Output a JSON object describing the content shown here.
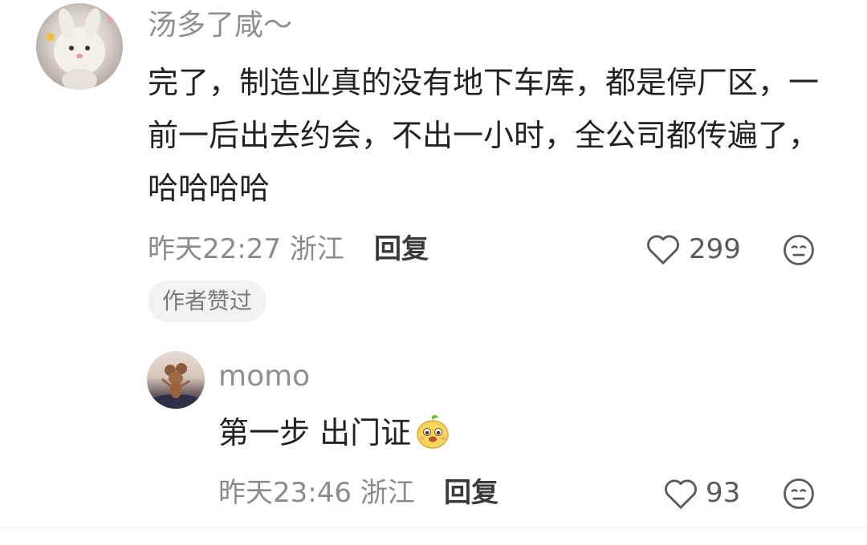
{
  "comment": {
    "username": "汤多了咸～",
    "text": "完了，制造业真的没有地下车库，都是停厂区，一前一后出去约会，不出一小时，全公司都传遍了，哈哈哈哈",
    "meta": "昨天22:27 浙江",
    "reply_label": "回复",
    "likes": "299",
    "badge": "作者赞过"
  },
  "reply": {
    "username": "momo",
    "text": "第一步 出门证",
    "emoji": "mango-face-emoji",
    "meta": "昨天23:46 浙江",
    "reply_label": "回复",
    "likes": "93"
  },
  "icons": {
    "like": "heart-outline-icon",
    "reaction": "neutral-face-icon"
  },
  "colors": {
    "text_primary": "#222222",
    "text_secondary": "#8b8b8b",
    "badge_bg": "#f2f2f2"
  }
}
